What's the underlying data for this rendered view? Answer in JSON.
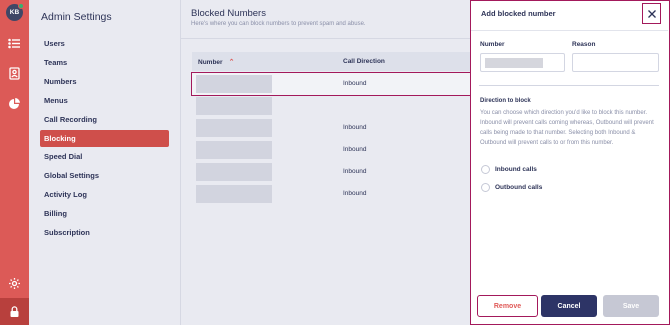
{
  "rail": {
    "avatar_initials": "KB",
    "icons": [
      "list-icon",
      "contact-book-icon",
      "pie-chart-icon",
      "gear-icon",
      "lock-icon"
    ],
    "colors": {
      "background": "#dc5a57",
      "active": "#b8403d"
    }
  },
  "settings": {
    "title": "Admin Settings",
    "items": [
      {
        "label": "Users"
      },
      {
        "label": "Teams"
      },
      {
        "label": "Numbers"
      },
      {
        "label": "Menus"
      },
      {
        "label": "Call Recording"
      },
      {
        "label": "Blocking",
        "active": true
      },
      {
        "label": "Speed Dial"
      },
      {
        "label": "Global Settings"
      },
      {
        "label": "Activity Log"
      },
      {
        "label": "Billing"
      },
      {
        "label": "Subscription"
      }
    ]
  },
  "main": {
    "title": "Blocked Numbers",
    "subtitle": "Here's where you can block numbers to prevent spam and abuse.",
    "table": {
      "headers": {
        "number": "Number",
        "direction": "Call Direction"
      },
      "rows": [
        {
          "direction": "Inbound"
        },
        {
          "direction": ""
        },
        {
          "direction": "Inbound"
        },
        {
          "direction": "Inbound"
        },
        {
          "direction": "Inbound"
        },
        {
          "direction": "Inbound"
        }
      ]
    }
  },
  "panel": {
    "title": "Add blocked number",
    "number_label": "Number",
    "reason_label": "Reason",
    "number_value": "",
    "reason_value": "",
    "direction_title": "Direction to block",
    "direction_desc": "You can choose which direction you'd like to block this number. Inbound will prevent calls coming whereas, Outbound will prevent calls being made to that number. Selecting both Inbound & Outbound will prevent calls to or from this number.",
    "inbound_label": "Inbound calls",
    "outbound_label": "Outbound calls",
    "remove_label": "Remove",
    "cancel_label": "Cancel",
    "save_label": "Save"
  },
  "colors": {
    "accent": "#dc5a57",
    "focus_outline": "#a3195b",
    "primary_button": "#2d3466",
    "disabled_button": "#c6c8d4"
  }
}
